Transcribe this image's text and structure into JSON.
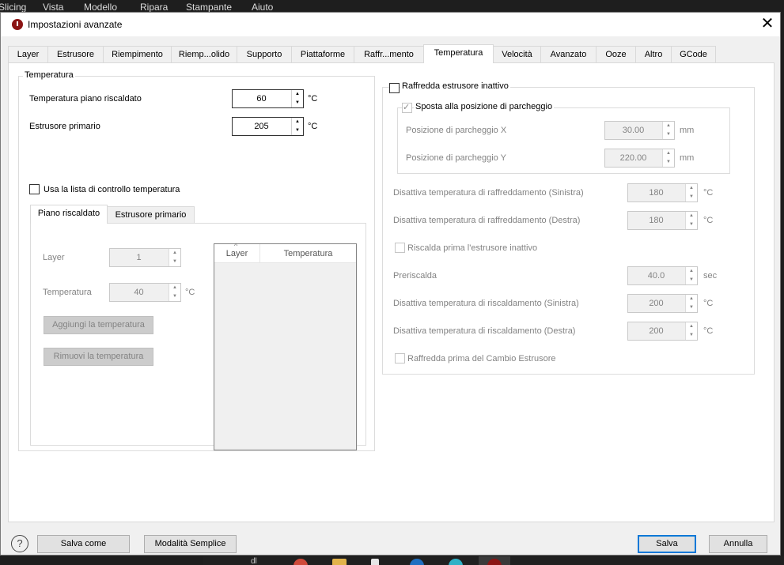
{
  "menubar": {
    "items": [
      "Slicing",
      "Vista",
      "Modello",
      "Ripara",
      "Stampante",
      "Aiuto"
    ]
  },
  "dialog": {
    "title": "Impostazioni avanzate",
    "close_symbol": "✕"
  },
  "tabs": [
    {
      "label": "Layer"
    },
    {
      "label": "Estrusore"
    },
    {
      "label": "Riempimento"
    },
    {
      "label": "Riemp...olido"
    },
    {
      "label": "Supporto"
    },
    {
      "label": "Piattaforme"
    },
    {
      "label": "Raffr...mento"
    },
    {
      "label": "Temperatura",
      "active": true
    },
    {
      "label": "Velocità"
    },
    {
      "label": "Avanzato"
    },
    {
      "label": "Ooze"
    },
    {
      "label": "Altro"
    },
    {
      "label": "GCode"
    }
  ],
  "temperatura": {
    "legend": "Temperatura",
    "bed_label": "Temperatura piano riscaldato",
    "bed_value": "60",
    "bed_unit": "°C",
    "primary_label": "Estrusore primario",
    "primary_value": "205",
    "primary_unit": "°C",
    "control_list_label": "Usa la lista di controllo temperatura",
    "inner_tabs": [
      "Piano riscaldato",
      "Estrusore primario"
    ],
    "layer_label": "Layer",
    "layer_value": "1",
    "temp_label": "Temperatura",
    "temp_value": "40",
    "temp_unit": "°C",
    "add_button": "Aggiungi la temperatura",
    "remove_button": "Rimuovi la temperatura",
    "table_columns": [
      "Layer",
      "Temperatura"
    ]
  },
  "inactive": {
    "legend": "Raffredda estrusore inattivo",
    "park_legend": "Sposta alla posizione di parcheggio",
    "park_x_label": "Posizione di parcheggio X",
    "park_x_value": "30.00",
    "park_y_label": "Posizione di parcheggio Y",
    "park_y_value": "220.00",
    "mm": "mm",
    "cool_left_label": "Disattiva temperatura di raffreddamento (Sinistra)",
    "cool_left_value": "180",
    "cool_right_label": "Disattiva temperatura di raffreddamento (Destra)",
    "cool_right_value": "180",
    "preheat_first_label": "Riscalda prima l'estrusore inattivo",
    "preheat_label": "Preriscalda",
    "preheat_value": "40.0",
    "sec": "sec",
    "heat_left_label": "Disattiva temperatura di riscaldamento (Sinistra)",
    "heat_left_value": "200",
    "heat_right_label": "Disattiva temperatura di riscaldamento (Destra)",
    "heat_right_value": "200",
    "celsius": "°C",
    "cool_before_label": "Raffredda prima del Cambio Estrusore"
  },
  "footer": {
    "help_symbol": "?",
    "save_as": "Salva come",
    "simple_mode": "Modalità Semplice",
    "save": "Salva",
    "cancel": "Annulla"
  },
  "taskbar": {
    "text": "dl"
  }
}
